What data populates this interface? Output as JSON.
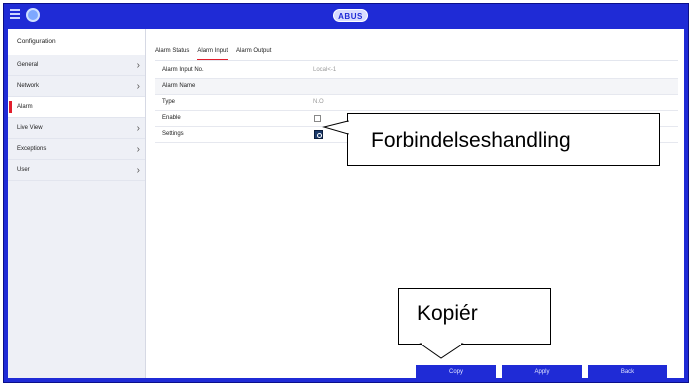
{
  "titlebar": {
    "logo": "ABUS",
    "menu_icon": "hamburger-icon",
    "gear_icon": "gear-icon"
  },
  "sidebar": {
    "title": "Configuration",
    "items": [
      {
        "label": "General",
        "chevron": true
      },
      {
        "label": "Network",
        "chevron": true
      },
      {
        "label": "Alarm",
        "chevron": false,
        "active": true
      },
      {
        "label": "Live View",
        "chevron": true
      },
      {
        "label": "Exceptions",
        "chevron": true
      },
      {
        "label": "User",
        "chevron": true
      }
    ]
  },
  "tabs": [
    {
      "label": "Alarm Status"
    },
    {
      "label": "Alarm Input",
      "active": true
    },
    {
      "label": "Alarm Output"
    }
  ],
  "form": {
    "alarm_input_no_label": "Alarm Input No.",
    "alarm_input_no_value": "Local<-1",
    "alarm_name_label": "Alarm Name",
    "alarm_name_value": "",
    "type_label": "Type",
    "type_value": "N.O",
    "enable_label": "Enable",
    "enable_checked": false,
    "settings_label": "Settings"
  },
  "buttons": {
    "copy": "Copy",
    "apply": "Apply",
    "back": "Back"
  },
  "annotations": {
    "settings_callout": "Forbindelseshandling",
    "copy_callout": "Kopiér"
  },
  "colors": {
    "frame_blue": "#1f2bd6",
    "accent_red": "#e21d2c"
  }
}
